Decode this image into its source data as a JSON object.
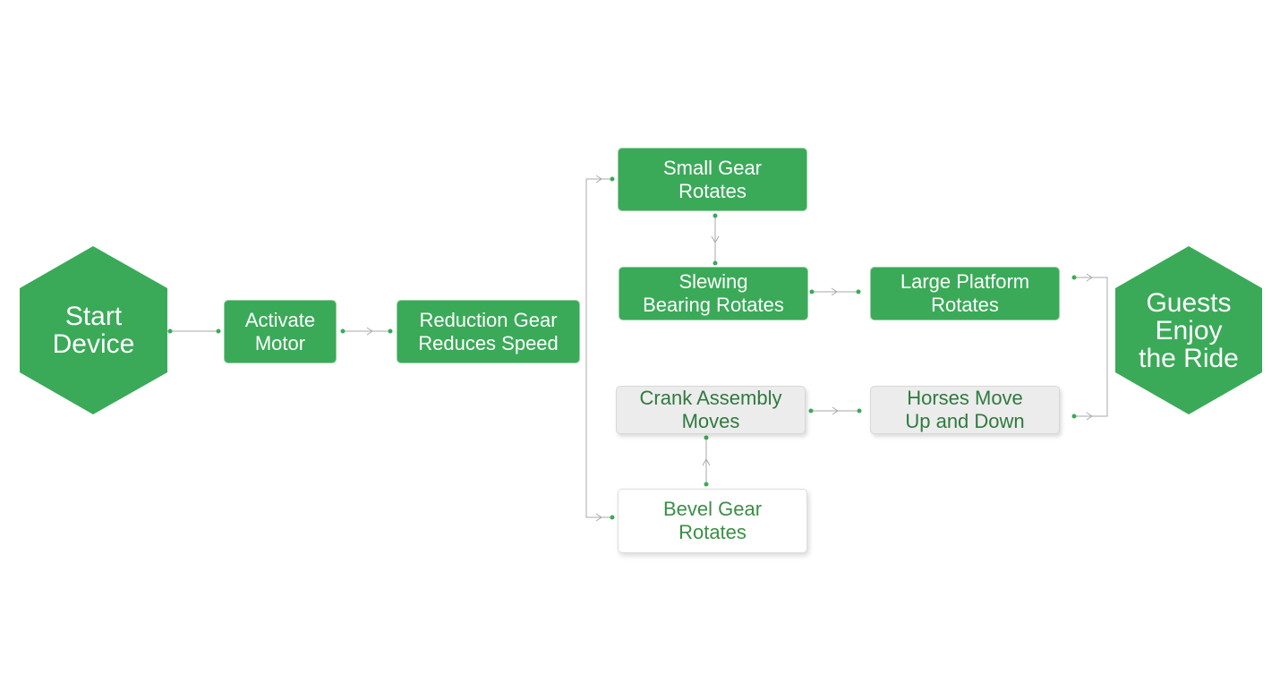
{
  "nodes": {
    "start": "Start\nDevice",
    "activate": "Activate\nMotor",
    "reduction": "Reduction Gear\nReduces Speed",
    "small_gear": "Small Gear\nRotates",
    "slewing": "Slewing\nBearing Rotates",
    "large_platform": "Large Platform\nRotates",
    "crank": "Crank Assembly\nMoves",
    "horses": "Horses Move\nUp and Down",
    "bevel": "Bevel Gear\nRotates",
    "guests": "Guests\nEnjoy\nthe Ride"
  },
  "colors": {
    "primary": "#3aaa58",
    "connector": "#aaaaaa",
    "secondary_fill": "#ececec"
  }
}
